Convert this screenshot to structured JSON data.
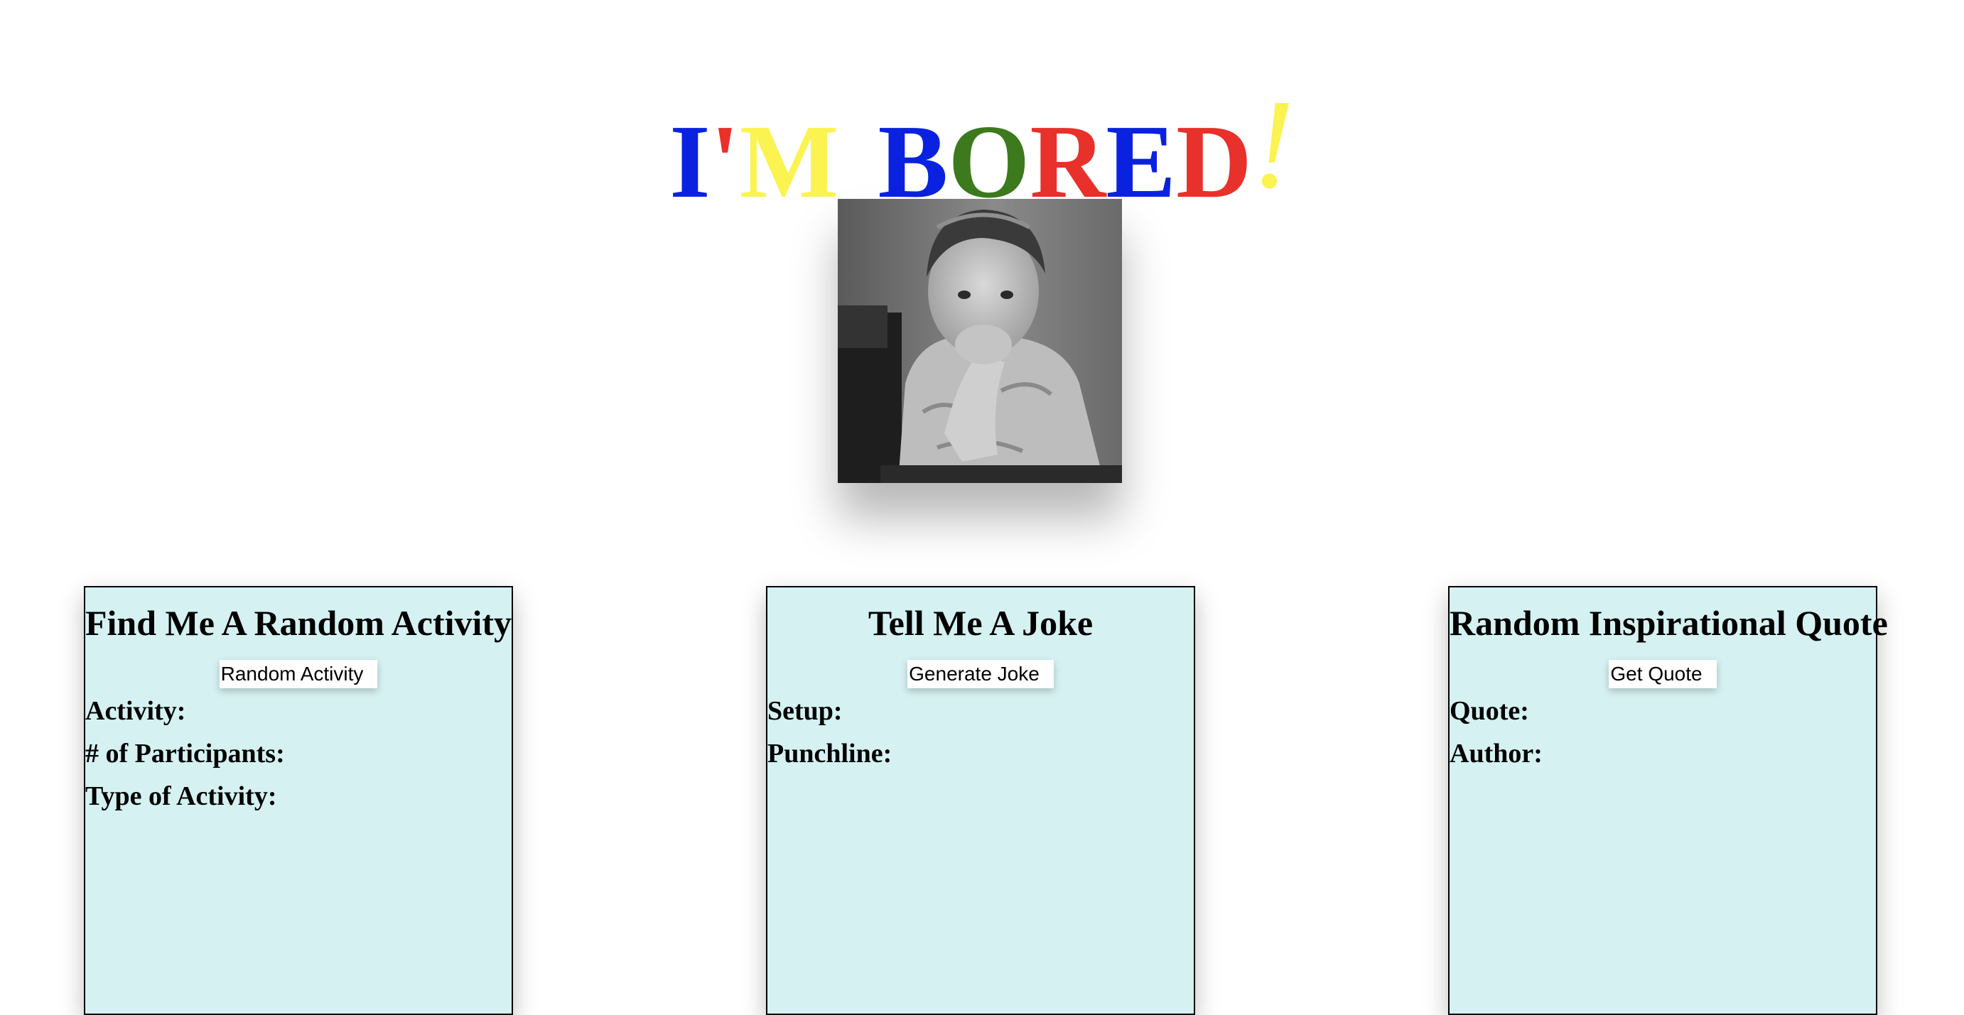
{
  "header": {
    "letters": [
      {
        "char": "I",
        "color": "#0a22e0"
      },
      {
        "char": "'",
        "color": "#e8312a"
      },
      {
        "char": "M",
        "color": "#fbf34f"
      },
      {
        "char": " ",
        "color": "#ffffff"
      },
      {
        "char": "B",
        "color": "#0a22e0"
      },
      {
        "char": "O",
        "color": "#3c7a1d"
      },
      {
        "char": "R",
        "color": "#e8312a"
      },
      {
        "char": "E",
        "color": "#0a22e0"
      },
      {
        "char": "D",
        "color": "#e8312a"
      },
      {
        "char": "!",
        "color": "#fbf34f"
      }
    ]
  },
  "hero_image": {
    "icon": "bored-child-photo"
  },
  "cards": [
    {
      "title": "Find Me A Random Activity",
      "button": "Random Activity",
      "fields": [
        "Activity:",
        "# of Participants:",
        "Type of Activity:"
      ]
    },
    {
      "title": "Tell Me A Joke",
      "button": "Generate Joke",
      "fields": [
        "Setup:",
        "Punchline:"
      ]
    },
    {
      "title": "Random Inspirational Quote",
      "button": "Get Quote",
      "fields": [
        "Quote:",
        "Author:"
      ]
    }
  ],
  "colors": {
    "card_background": "#d5f1f1",
    "card_border": "#000000"
  }
}
